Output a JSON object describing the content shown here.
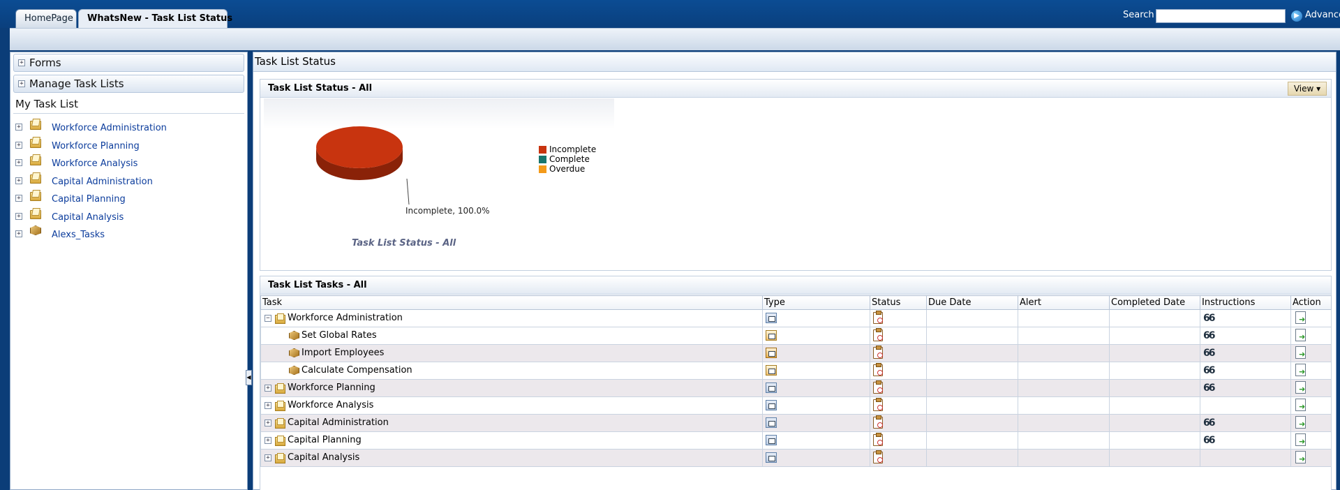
{
  "tabs": [
    {
      "label": "HomePage",
      "active": false
    },
    {
      "label": "WhatsNew - Task List Status",
      "active": true
    }
  ],
  "search": {
    "label": "Search",
    "value": "",
    "advanced_label": "Advanced"
  },
  "left_panel": {
    "forms_label": "Forms",
    "manage_label": "Manage Task Lists",
    "my_task_list_label": "My Task List",
    "items": [
      {
        "label": "Workforce Administration",
        "icon": "folder-icon"
      },
      {
        "label": "Workforce Planning",
        "icon": "folder-icon"
      },
      {
        "label": "Workforce Analysis",
        "icon": "folder-icon"
      },
      {
        "label": "Capital Administration",
        "icon": "folder-icon"
      },
      {
        "label": "Capital Planning",
        "icon": "folder-icon"
      },
      {
        "label": "Capital Analysis",
        "icon": "folder-icon"
      },
      {
        "label": "Alexs_Tasks",
        "icon": "cube-icon"
      }
    ]
  },
  "main": {
    "title": "Task List Status",
    "status_panel": {
      "title": "Task List Status - All",
      "view_label": "View"
    },
    "tasks_panel": {
      "title": "Task List Tasks - All",
      "columns": [
        "Task",
        "Type",
        "Status",
        "Due Date",
        "Alert",
        "Completed Date",
        "Instructions",
        "Action"
      ]
    }
  },
  "chart_data": {
    "type": "pie",
    "title": "Task List Status - All",
    "categories": [
      "Incomplete",
      "Complete",
      "Overdue"
    ],
    "values": [
      100.0,
      0.0,
      0.0
    ],
    "colors": [
      "#c8340f",
      "#17756e",
      "#f39a1a"
    ],
    "data_label": "Incomplete, 100.0%",
    "legend_position": "right"
  },
  "task_rows": [
    {
      "task": "Workforce Administration",
      "level": 0,
      "expander": "minus",
      "icon": "folder",
      "type": "list",
      "instructions": true,
      "alt": false
    },
    {
      "task": "Set Global Rates",
      "level": 1,
      "expander": "",
      "icon": "cube",
      "type": "doc",
      "instructions": true,
      "alt": false
    },
    {
      "task": "Import Employees",
      "level": 1,
      "expander": "",
      "icon": "cube",
      "type": "edit",
      "instructions": true,
      "alt": true
    },
    {
      "task": "Calculate Compensation",
      "level": 1,
      "expander": "",
      "icon": "cube",
      "type": "doc",
      "instructions": true,
      "alt": false
    },
    {
      "task": "Workforce Planning",
      "level": 0,
      "expander": "plus",
      "icon": "folder",
      "type": "list",
      "instructions": true,
      "alt": true
    },
    {
      "task": "Workforce Analysis",
      "level": 0,
      "expander": "plus",
      "icon": "folder",
      "type": "list",
      "instructions": false,
      "alt": false
    },
    {
      "task": "Capital Administration",
      "level": 0,
      "expander": "plus",
      "icon": "folder",
      "type": "list",
      "instructions": true,
      "alt": true
    },
    {
      "task": "Capital Planning",
      "level": 0,
      "expander": "plus",
      "icon": "folder",
      "type": "list",
      "instructions": true,
      "alt": false
    },
    {
      "task": "Capital Analysis",
      "level": 0,
      "expander": "plus",
      "icon": "folder",
      "type": "list",
      "instructions": false,
      "alt": true
    }
  ]
}
